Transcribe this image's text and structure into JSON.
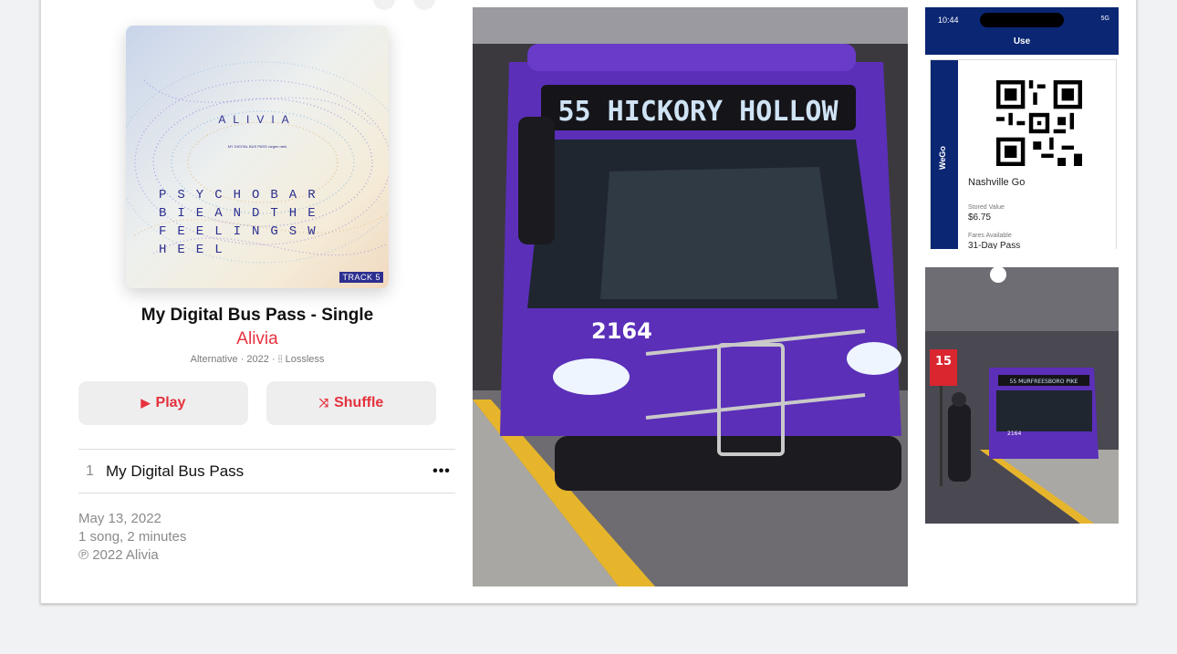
{
  "album": {
    "cover_artist": "ALIVIA",
    "cover_small": "MY DIGITAL BUS PASS vizgen rank",
    "cover_lines": [
      "PSYCHOBAR",
      "BIEANDTHE",
      "FEELINGSW",
      "HEEL"
    ],
    "cover_badge": "TRACK 5",
    "title": "My Digital Bus Pass - Single",
    "artist": "Alivia",
    "meta": "Alternative · 2022 · ⦙⦙ Lossless"
  },
  "actions": {
    "play_label": "Play",
    "play_icon": "play-icon",
    "shuffle_label": "Shuffle",
    "shuffle_icon": "shuffle-icon"
  },
  "tracks": [
    {
      "number": "1",
      "title": "My Digital Bus Pass"
    }
  ],
  "footer": {
    "date": "May 13, 2022",
    "summary": "1 song, 2 minutes",
    "copyright": "℗ 2022 Alivia"
  },
  "bus_photo": {
    "route_sign": "55 HICKORY HOLLOW",
    "fleet_number": "2164",
    "bus_color": "#5b2fb8"
  },
  "phone_screen": {
    "time": "10:44",
    "signal": "5G",
    "header": "Use",
    "agency": "Nashville Go",
    "logo_text": "WeGo",
    "stored_value_label": "Stored Value",
    "stored_value": "$6.75",
    "fares_label": "Fares Available",
    "fares_value": "31-Day Pass",
    "brand_color": "#0b2673"
  },
  "bus_small_photo": {
    "route_sign": "55 MURFREESBORO PIKE",
    "stop_sign": "15",
    "fleet_number": "2164"
  },
  "colors": {
    "accent": "#e5323d",
    "button_bg": "#eeeeef"
  }
}
